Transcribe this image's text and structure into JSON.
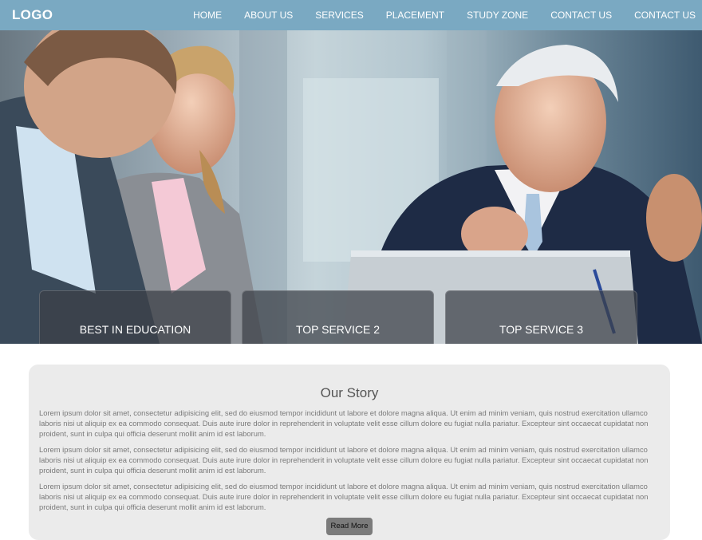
{
  "header": {
    "logo": "LOGO",
    "nav": [
      "HOME",
      "ABOUT US",
      "SERVICES",
      "PLACEMENT",
      "STUDY ZONE",
      "CONTACT US",
      "CONTACT US"
    ]
  },
  "hero": {
    "image_alt": "Business meeting photo",
    "boxes": [
      "BEST IN EDUCATION",
      "TOP SERVICE 2",
      "TOP SERVICE 3"
    ]
  },
  "story": {
    "title": "Our Story",
    "paragraphs": [
      "Lorem ipsum dolor sit amet, consectetur adipisicing elit, sed do eiusmod tempor incididunt ut labore et dolore magna aliqua. Ut enim ad minim veniam, quis nostrud exercitation ullamco laboris nisi ut aliquip ex ea commodo consequat. Duis aute irure dolor in reprehenderit in voluptate velit esse cillum dolore eu fugiat nulla pariatur. Excepteur sint occaecat cupidatat non proident, sunt in culpa qui officia deserunt mollit anim id est laborum.",
      "Lorem ipsum dolor sit amet, consectetur adipisicing elit, sed do eiusmod tempor incididunt ut labore et dolore magna aliqua. Ut enim ad minim veniam, quis nostrud exercitation ullamco laboris nisi ut aliquip ex ea commodo consequat. Duis aute irure dolor in reprehenderit in voluptate velit esse cillum dolore eu fugiat nulla pariatur. Excepteur sint occaecat cupidatat non proident, sunt in culpa qui officia deserunt mollit anim id est laborum.",
      "Lorem ipsum dolor sit amet, consectetur adipisicing elit, sed do eiusmod tempor incididunt ut labore et dolore magna aliqua. Ut enim ad minim veniam, quis nostrud exercitation ullamco laboris nisi ut aliquip ex ea commodo consequat. Duis aute irure dolor in reprehenderit in voluptate velit esse cillum dolore eu fugiat nulla pariatur. Excepteur sint occaecat cupidatat non proident, sunt in culpa qui officia deserunt mollit anim id est laborum."
    ],
    "button": "Read More"
  },
  "colors": {
    "navbar": "#7aa9c2",
    "panel": "#ebebeb",
    "button": "#7b7b7b"
  }
}
